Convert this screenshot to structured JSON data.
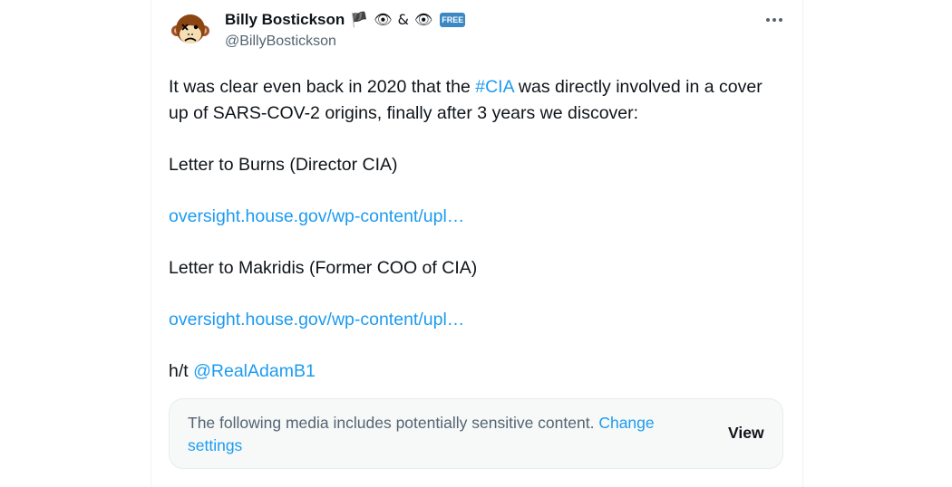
{
  "user": {
    "display_name": "Billy Bostickson",
    "name_emojis": [
      "🏴",
      "👁",
      "&",
      "👁"
    ],
    "badge": "FREE",
    "handle": "@BillyBostickson"
  },
  "tweet": {
    "line1_prefix": "It was clear even back in 2020 that the",
    "hashtag": "#CIA",
    "line1_suffix": " was directly involved in a cover up of SARS-COV-2 origins, finally after 3 years we discover:",
    "letter1": "Letter to Burns (Director CIA)",
    "link1": "oversight.house.gov/wp-content/upl…",
    "letter2": "Letter to Makridis (Former COO of CIA)",
    "link2": "oversight.house.gov/wp-content/upl…",
    "ht_prefix": "h/t",
    "mention": "@RealAdamB1"
  },
  "media_warning": {
    "text": "The following media includes potentially sensitive content.",
    "link": "Change settings",
    "button": "View"
  },
  "colors": {
    "link": "#1d9bf0",
    "muted": "#536471",
    "text": "#0f1419",
    "warning_bg": "#f7f9f9"
  },
  "icons": {
    "avatar": "monkey-avatar",
    "more": "more-horizontal-icon"
  }
}
